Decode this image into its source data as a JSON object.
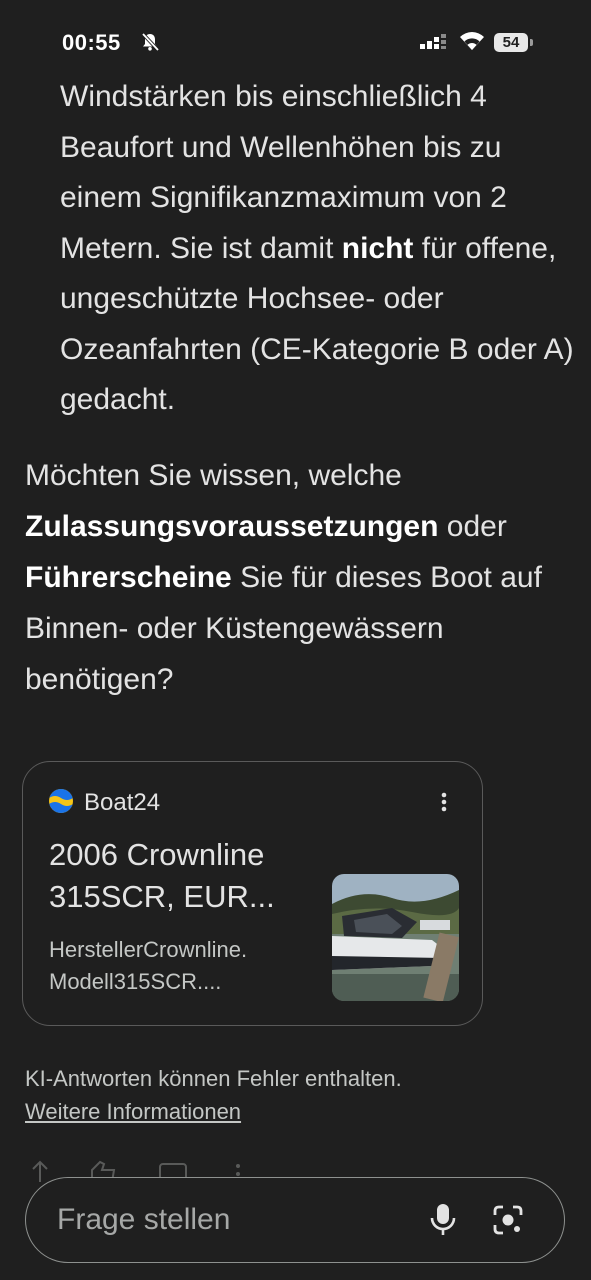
{
  "status": {
    "time": "00:55",
    "battery": "54"
  },
  "answer": {
    "list_segments": [
      {
        "text": "Windstärken bis einschließlich 4 Beaufort und Wellenhöhen bis zu einem Signifikanzmaximum von 2 Metern. Sie ist damit ",
        "bold": false
      },
      {
        "text": "nicht",
        "bold": true
      },
      {
        "text": " für offene, ungeschützte Hochsee- oder Ozeanfahrten (CE-Kategorie B oder A) gedacht.",
        "bold": false
      }
    ],
    "follow_segments": [
      {
        "text": "Möchten Sie wissen, welche ",
        "bold": false
      },
      {
        "text": "Zulassungsvoraussetzungen",
        "bold": true
      },
      {
        "text": " oder ",
        "bold": false
      },
      {
        "text": "Führerscheine",
        "bold": true
      },
      {
        "text": " Sie für dieses Boot auf Binnen- oder Küstengewässern benötigen?",
        "bold": false
      }
    ]
  },
  "source_card": {
    "source": "Boat24",
    "title": "2006 Crownline 315SCR, EUR...",
    "snippet": "HerstellerCrownline. Modell315SCR....",
    "logo_icon": "boat24-logo-icon",
    "thumbnail": "boat-thumbnail"
  },
  "footer": {
    "disclaimer": "KI-Antworten können Fehler enthalten.",
    "more_info": "Weitere Informationen"
  },
  "ask": {
    "placeholder": "Frage stellen"
  },
  "colors": {
    "background": "#1f1f1f",
    "text": "#e3e3e3",
    "secondary": "#c4c7c5",
    "border": "#5a5a5a"
  }
}
